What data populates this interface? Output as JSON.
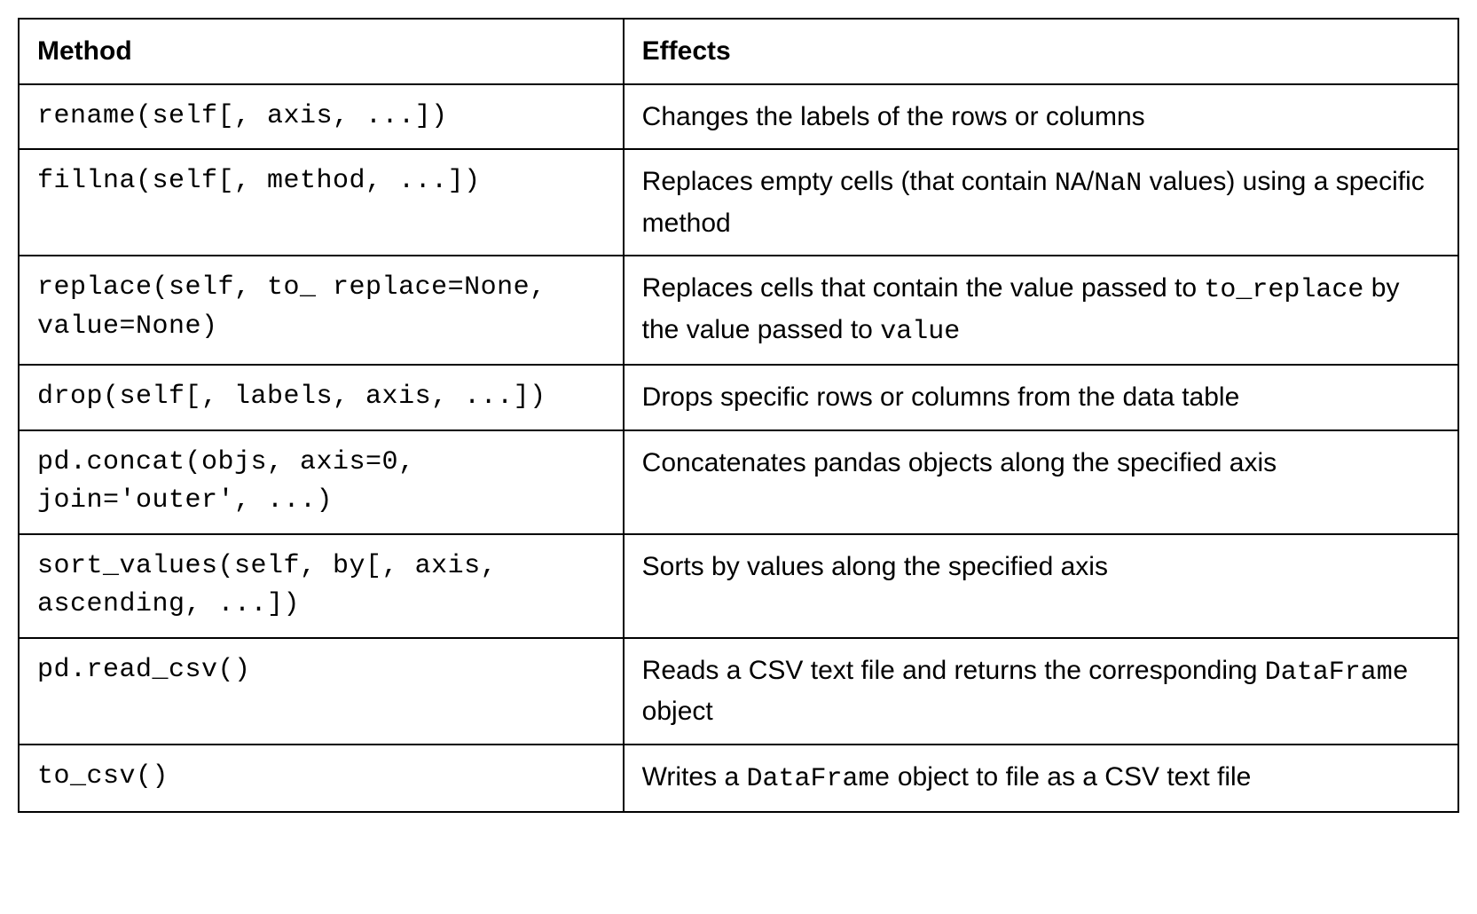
{
  "table": {
    "headers": {
      "method": "Method",
      "effects": "Effects"
    },
    "rows": [
      {
        "method": "rename(self[, axis, ...])",
        "effect_text": "Changes the labels of the rows or columns"
      },
      {
        "method": "fillna(self[, method, ...])",
        "effect_pre": "Replaces empty cells (that contain ",
        "effect_code1": "NA",
        "effect_mid1": "/",
        "effect_code2": "NaN",
        "effect_post": " values) using a specific method"
      },
      {
        "method": "replace(self, to_ replace=None, value=None)",
        "effect_pre": "Replaces cells that contain the value passed to ",
        "effect_code1": "to_replace",
        "effect_mid1": " by the value passed to ",
        "effect_code2": "value",
        "effect_post": ""
      },
      {
        "method": "drop(self[, labels, axis, ...])",
        "effect_text": "Drops specific rows or columns from the data table"
      },
      {
        "method": "pd.concat(objs, axis=0, join='outer', ...)",
        "effect_text": "Concatenates pandas objects along the specified axis"
      },
      {
        "method": "sort_values(self, by[, axis, ascending, ...])",
        "effect_text": "Sorts by values along the specified axis"
      },
      {
        "method": "pd.read_csv()",
        "effect_pre": "Reads a CSV text file and returns the corresponding ",
        "effect_code1": "DataFrame",
        "effect_post": " object"
      },
      {
        "method": "to_csv()",
        "effect_pre": "Writes a ",
        "effect_code1": "DataFrame",
        "effect_post": " object to file as a CSV text file"
      }
    ]
  }
}
